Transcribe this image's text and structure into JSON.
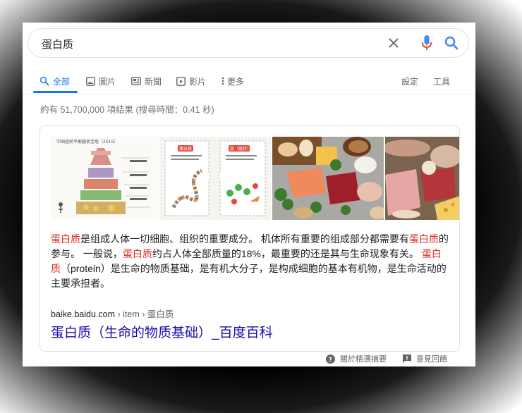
{
  "search": {
    "query": "蛋白质"
  },
  "tabs": [
    {
      "label": "全部",
      "icon": "search-icon",
      "active": true
    },
    {
      "label": "圖片",
      "icon": "image-icon"
    },
    {
      "label": "新聞",
      "icon": "news-icon"
    },
    {
      "label": "影片",
      "icon": "video-icon"
    },
    {
      "label": "更多",
      "icon": "more-icon"
    }
  ],
  "tools": {
    "settings": "設定",
    "tools": "工具"
  },
  "stats": "約有 51,700,000 項結果 (搜尋時間：0.41 秒)",
  "snippet": {
    "images": [
      {
        "name": "food-pyramid-image",
        "caption": "中国居民平衡膳食宝塔（2016）"
      },
      {
        "name": "protein-digestion-diagram",
        "labels": [
          "蛋白质",
          "肽（链状）"
        ]
      },
      {
        "name": "protein-foods-photo"
      },
      {
        "name": "meat-cheese-photo"
      }
    ],
    "desc": {
      "p1_hl": "蛋白质",
      "p1": "是组成人体一切细胞、组织的重要成分。 机体所有重要的组成部分都需要有",
      "p2_hl": "蛋白质",
      "p2": "的参与。 一般说，",
      "p3_hl": "蛋白质",
      "p3": "约占人体全部质量的18%，最重要的还是其与生命现象有关。 ",
      "p4_hl": "蛋白质",
      "p4": "（protein）是生命的物质基础，是有机大分子，是构成细胞的基本有机物，是生命活动的主要承担者。"
    },
    "source_domain": "baike.baidu.com",
    "source_path": " › item › 蛋白质",
    "title": "蛋白质（生命的物质基础）_百度百科"
  },
  "footer": {
    "about": "關於精選摘要",
    "feedback": "意見回饋"
  },
  "colors": {
    "accent": "#1a73e8",
    "link": "#1a0dab",
    "highlight": "#d93025"
  }
}
